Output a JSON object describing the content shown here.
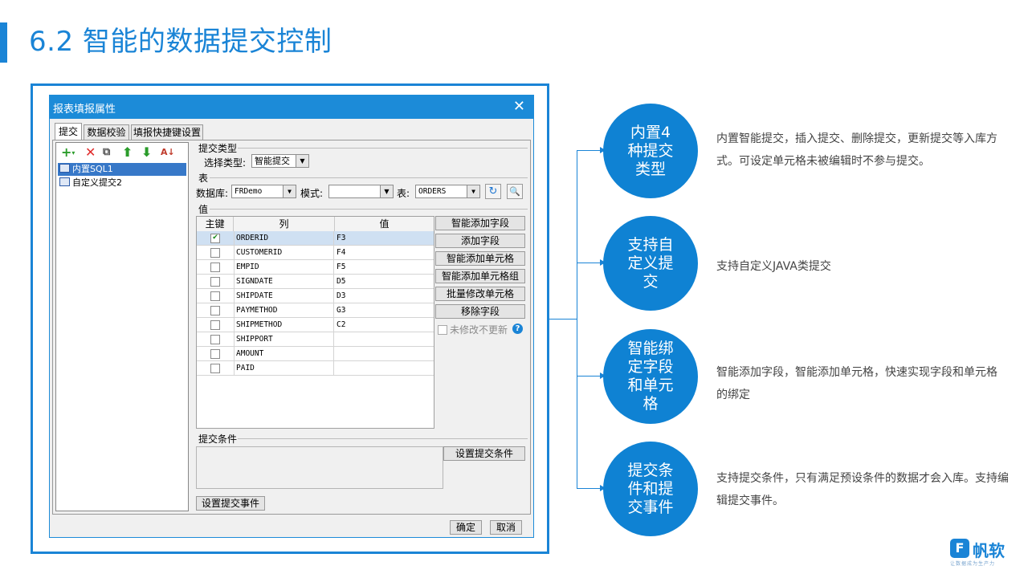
{
  "slide": {
    "title": "6.2 智能的数据提交控制"
  },
  "dialog": {
    "title": "报表填报属性",
    "tabs": [
      "提交",
      "数据校验",
      "填报快捷键设置"
    ],
    "toolbar_icons": [
      "add-icon",
      "delete-icon",
      "copy-icon",
      "move-up-icon",
      "move-down-icon",
      "sort-icon"
    ],
    "tree": [
      {
        "label": "内置SQL1",
        "selected": true
      },
      {
        "label": "自定义提交2",
        "selected": false
      }
    ],
    "submit_type": {
      "section_label": "提交类型",
      "select_label": "选择类型:",
      "value": "智能提交"
    },
    "table_section": {
      "section_label": "表",
      "database_label": "数据库:",
      "database_value": "FRDemo",
      "schema_label": "模式:",
      "schema_value": "",
      "table_label": "表:",
      "table_value": "ORDERS"
    },
    "value_section": {
      "section_label": "值",
      "headers": [
        "主键",
        "列",
        "值"
      ],
      "rows": [
        {
          "key": true,
          "column": "ORDERID",
          "value": "F3",
          "selected": true
        },
        {
          "key": false,
          "column": "CUSTOMERID",
          "value": "F4"
        },
        {
          "key": false,
          "column": "EMPID",
          "value": "F5"
        },
        {
          "key": false,
          "column": "SIGNDATE",
          "value": "D5"
        },
        {
          "key": false,
          "column": "SHIPDATE",
          "value": "D3"
        },
        {
          "key": false,
          "column": "PAYMETHOD",
          "value": "G3"
        },
        {
          "key": false,
          "column": "SHIPMETHOD",
          "value": "C2"
        },
        {
          "key": false,
          "column": "SHIPPORT",
          "value": ""
        },
        {
          "key": false,
          "column": "AMOUNT",
          "value": ""
        },
        {
          "key": false,
          "column": "PAID",
          "value": ""
        }
      ],
      "buttons": [
        "智能添加字段",
        "添加字段",
        "智能添加单元格",
        "智能添加单元格组",
        "批量修改单元格",
        "移除字段"
      ],
      "unchanged_checkbox": "未修改不更新"
    },
    "condition_section": {
      "section_label": "提交条件",
      "button": "设置提交条件"
    },
    "event_button": "设置提交事件",
    "ok": "确定",
    "cancel": "取消"
  },
  "features": [
    {
      "title": "内置4种提交类型",
      "desc": "内置智能提交，插入提交、删除提交，更新提交等入库方式。可设定单元格未被编辑时不参与提交。"
    },
    {
      "title": "支持自定义提交",
      "desc": "支持自定义JAVA类提交"
    },
    {
      "title": "智能绑定字段和单元格",
      "desc": "智能添加字段，智能添加单元格，快速实现字段和单元格的绑定"
    },
    {
      "title": "提交条件和提交事件",
      "desc": "支持提交条件，只有满足预设条件的数据才会入库。支持编辑提交事件。"
    }
  ],
  "logo": {
    "mark": "F",
    "name": "帆软",
    "tagline": "让数据成为生产力"
  },
  "colors": {
    "accent": "#1a84d6",
    "circle": "#0f82d3"
  }
}
